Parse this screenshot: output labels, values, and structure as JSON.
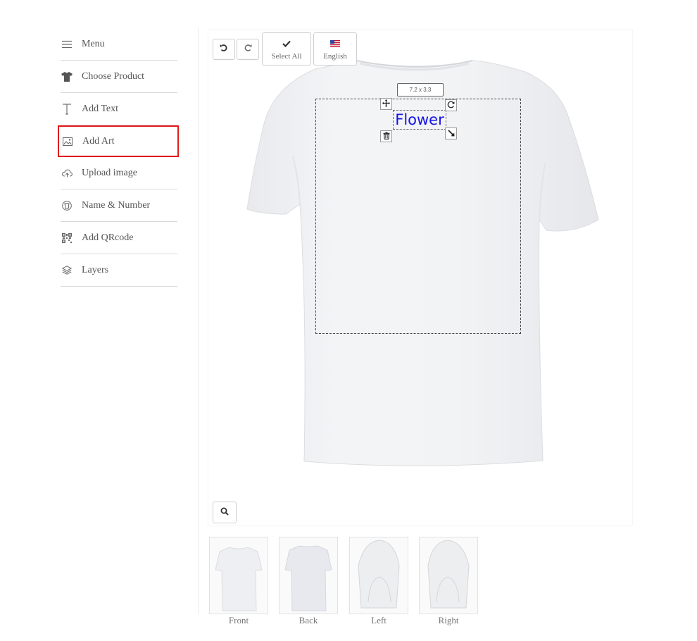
{
  "sidebar": {
    "items": [
      {
        "label": "Menu",
        "icon": "hamburger-icon"
      },
      {
        "label": "Choose Product",
        "icon": "tshirt-icon"
      },
      {
        "label": "Add Text",
        "icon": "text-icon"
      },
      {
        "label": "Add Art",
        "icon": "image-icon"
      },
      {
        "label": "Upload image",
        "icon": "cloud-upload-icon"
      },
      {
        "label": "Name & Number",
        "icon": "jersey-icon"
      },
      {
        "label": "Add QRcode",
        "icon": "qrcode-icon"
      },
      {
        "label": "Layers",
        "icon": "layers-icon"
      }
    ],
    "highlight_color": "#e01b1b"
  },
  "toolbar": {
    "undo_icon": "undo-icon",
    "redo_icon": "redo-icon",
    "select_all_label": "Select All",
    "language_label": "English"
  },
  "design": {
    "size_label": "7.2 x 3.3",
    "text": "Flower",
    "text_color": "#1414e6"
  },
  "views": [
    {
      "label": "Front"
    },
    {
      "label": "Back"
    },
    {
      "label": "Left"
    },
    {
      "label": "Right"
    }
  ]
}
